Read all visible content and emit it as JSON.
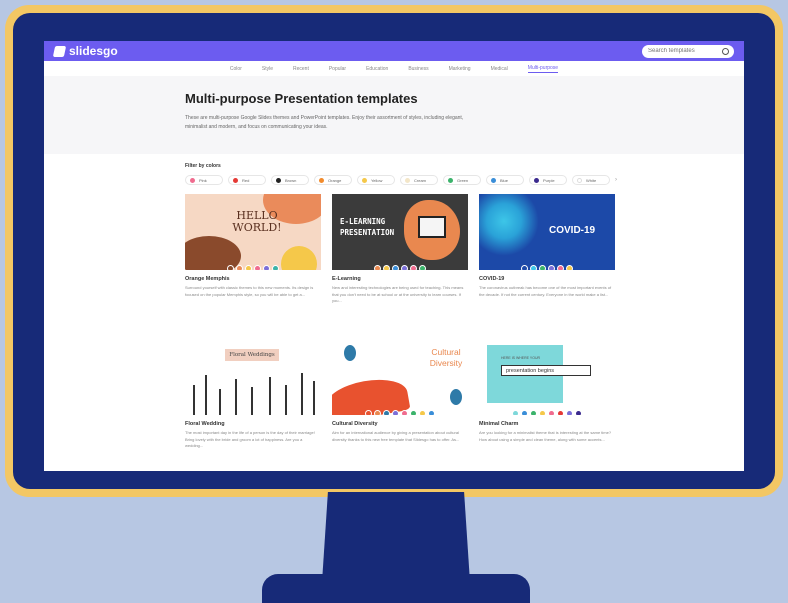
{
  "header": {
    "logo": "slidesgo",
    "search_placeholder": "Search templates"
  },
  "nav": {
    "categories": [
      "Color",
      "Style",
      "Recent",
      "Popular",
      "Education",
      "Business",
      "Marketing",
      "Medical",
      "Multi-purpose"
    ],
    "active_index": 8
  },
  "hero": {
    "title": "Multi-purpose Presentation templates",
    "description": "These are multi-purpose Google Slides themes and PowerPoint templates. Enjoy their assortment of styles, including elegant, minimalist and modern, and focus on communicating your ideas."
  },
  "filters": {
    "title": "Filter by colors",
    "colors": [
      {
        "label": "Pink",
        "hex": "#f06c8f"
      },
      {
        "label": "Red",
        "hex": "#e53935"
      },
      {
        "label": "Brown",
        "hex": "#222222"
      },
      {
        "label": "Orange",
        "hex": "#f28b2c"
      },
      {
        "label": "Yellow",
        "hex": "#f5c84a"
      },
      {
        "label": "Cream",
        "hex": "#f3e6c8"
      },
      {
        "label": "Green",
        "hex": "#3bb36b"
      },
      {
        "label": "Blue",
        "hex": "#3a8ed8"
      },
      {
        "label": "Purple",
        "hex": "#3b2a8e"
      },
      {
        "label": "White",
        "hex": "#ffffff"
      }
    ]
  },
  "templates": [
    {
      "title": "Orange Memphis",
      "thumb_text": "HELLO WORLD!",
      "description": "Surround yourself with classic themes to this new moments. Its design is focused on the popular Memphis style, so you will be able to get a...",
      "swatches": [
        "#8a4a2c",
        "#ea8b5b",
        "#f5c84a",
        "#f06c8f",
        "#7b6fd8",
        "#3bb3a8"
      ]
    },
    {
      "title": "E-Learning",
      "thumb_text": "E-LEARNING PRESENTATION",
      "description": "New and interesting technologies are being used for teaching. This means that you don't need to be at school or at the university to learn courses. If you...",
      "swatches": [
        "#e9884f",
        "#f5c84a",
        "#3a8ed8",
        "#7b6fd8",
        "#f06c8f",
        "#3bb36b"
      ]
    },
    {
      "title": "COVID-19",
      "thumb_text": "COVID-19",
      "description": "The coronavirus outbreak has become one of the most important events of the decade. If not the current century. Everyone in the world make a list...",
      "swatches": [
        "#1c49a8",
        "#3dc6e8",
        "#3bb36b",
        "#7b6fd8",
        "#f06c8f",
        "#f5c84a"
      ]
    },
    {
      "title": "Floral Wedding",
      "thumb_text": "Floral Weddings",
      "description": "The most important day in the life of a person is the day of their marriage! Bring lovely with the bride and groom a lot of happiness. Are you a wedding...",
      "swatches": []
    },
    {
      "title": "Cultural Diversity",
      "thumb_text": "Cultural Diversity",
      "description": "Aim for an international audience by giving a presentation about cultural diversity thanks to this new free template that Slidesgo has to offer. As...",
      "swatches": [
        "#e8522f",
        "#e9884f",
        "#2e7aa8",
        "#7b6fd8",
        "#f06c8f",
        "#3bb36b",
        "#f5c84a",
        "#3a8ed8"
      ]
    },
    {
      "title": "Minimal Charm",
      "thumb_text": "presentation begins",
      "thumb_subtext": "HERE IS WHERE YOUR",
      "description": "Are you looking for a minimalist theme that is interesting at the same time? How about using a simple and clean theme, along with some accents...",
      "swatches": [
        "#7ed8da",
        "#3a8ed8",
        "#3bb36b",
        "#f5c84a",
        "#f06c8f",
        "#e53935",
        "#7b6fd8",
        "#3b2a8e"
      ]
    }
  ]
}
